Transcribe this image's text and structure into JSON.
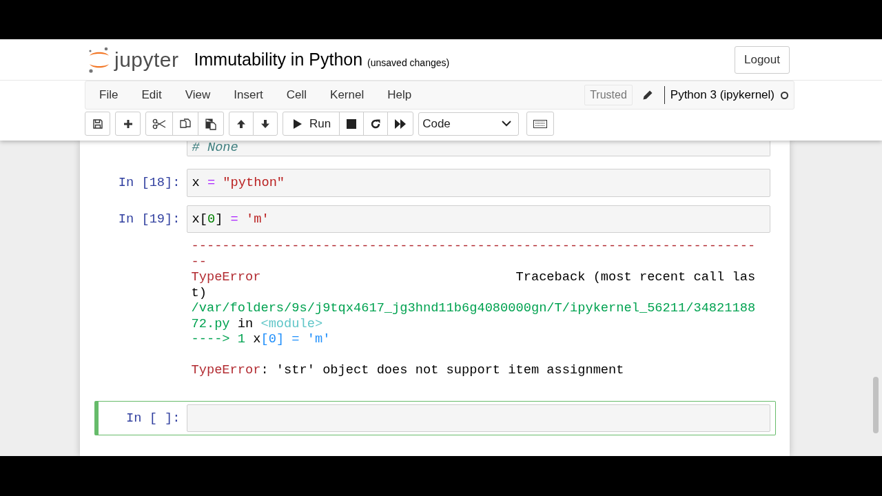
{
  "header": {
    "logo_text": "jupyter",
    "title": "Immutability in Python",
    "save_status": "(unsaved changes)",
    "logout": "Logout"
  },
  "menu": {
    "items": [
      "File",
      "Edit",
      "View",
      "Insert",
      "Cell",
      "Kernel",
      "Help"
    ],
    "trusted": "Trusted",
    "kernel_name": "Python 3 (ipykernel)",
    "kernel_busy": false
  },
  "toolbar": {
    "groups": [
      [
        {
          "kind": "save"
        }
      ],
      [
        {
          "kind": "add"
        }
      ],
      [
        {
          "kind": "cut"
        },
        {
          "kind": "copy"
        },
        {
          "kind": "paste"
        }
      ],
      [
        {
          "kind": "up"
        },
        {
          "kind": "down"
        }
      ],
      [
        {
          "kind": "run",
          "label": "Run"
        },
        {
          "kind": "stop"
        },
        {
          "kind": "restart"
        },
        {
          "kind": "run-all"
        }
      ],
      [
        {
          "kind": "cell-type",
          "label": "Code"
        }
      ],
      [
        {
          "kind": "keyboard"
        }
      ]
    ]
  },
  "cells": [
    {
      "selected": false,
      "partial": true,
      "code": [
        [
          {
            "text": "# None",
            "kind": "comment"
          }
        ]
      ]
    },
    {
      "prompt": "In [18]:",
      "selected": false,
      "code": [
        [
          {
            "text": "x ",
            "kind": "name"
          },
          {
            "text": "=",
            "kind": "operator"
          },
          {
            "text": " \"python\"",
            "kind": "string"
          }
        ]
      ]
    },
    {
      "prompt": "In [19]:",
      "selected": false,
      "code": [
        [
          {
            "text": "x[",
            "kind": "name"
          },
          {
            "text": "0",
            "kind": "number"
          },
          {
            "text": "] ",
            "kind": "name"
          },
          {
            "text": "=",
            "kind": "operator"
          },
          {
            "text": " 'm'",
            "kind": "string"
          }
        ]
      ],
      "output": [
        {
          "kind": "trace",
          "tokens": [
            {
              "text": "-------------------------------------------------------------------------",
              "kind": "error"
            }
          ]
        },
        {
          "kind": "trace",
          "tokens": [
            {
              "text": "--",
              "kind": "error"
            }
          ]
        },
        {
          "kind": "trace",
          "tokens": [
            {
              "text": "TypeError",
              "kind": "error"
            },
            {
              "text": "                                 Traceback (most recent call las",
              "kind": "plain"
            }
          ]
        },
        {
          "kind": "trace",
          "tokens": [
            {
              "text": "t)",
              "kind": "plain"
            }
          ]
        },
        {
          "kind": "trace",
          "tokens": [
            {
              "text": "/var/folders/9s/j9tqx4617_jg3hnd11b6g4080000gn/T/ipykernel_56211/34821188",
              "kind": "path"
            }
          ]
        },
        {
          "kind": "trace",
          "tokens": [
            {
              "text": "72.py",
              "kind": "path"
            },
            {
              "text": " in ",
              "kind": "plain"
            },
            {
              "text": "<module>",
              "kind": "module"
            }
          ]
        },
        {
          "kind": "trace",
          "tokens": [
            {
              "text": "---->",
              "kind": "path"
            },
            {
              "text": " 1",
              "kind": "path"
            },
            {
              "text": " x",
              "kind": "plain"
            },
            {
              "text": "[0] = 'm'",
              "kind": "blue"
            }
          ]
        },
        {
          "kind": "message",
          "tokens": [
            {
              "text": "TypeError",
              "kind": "error"
            },
            {
              "text": ": 'str' object does not support item assignment",
              "kind": "plain"
            }
          ]
        }
      ]
    },
    {
      "prompt": "In [ ]:",
      "selected": true
    }
  ]
}
